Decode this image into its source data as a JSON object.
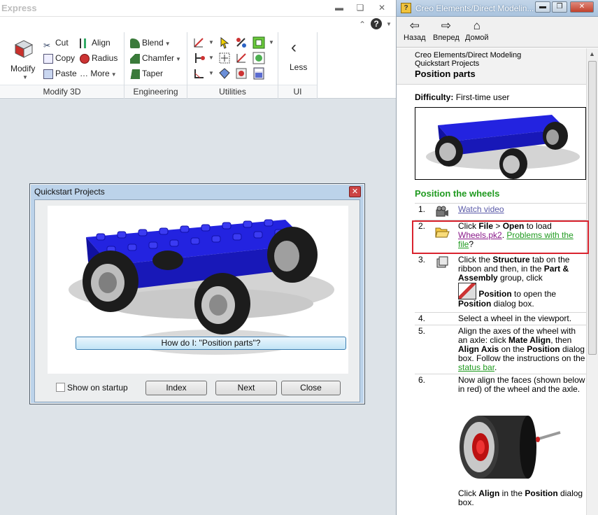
{
  "app": {
    "title": "Express"
  },
  "ribbon": {
    "modify": {
      "label": "Modify",
      "group": "Modify 3D"
    },
    "cut": "Cut",
    "copy": "Copy",
    "paste": "Paste",
    "align": "Align",
    "radius": "Radius",
    "more": "More",
    "blend": "Blend",
    "chamfer": "Chamfer",
    "taper": "Taper",
    "less": "Less",
    "groups": {
      "modify3d": "Modify 3D",
      "engineering": "Engineering",
      "utilities": "Utilities",
      "ui": "UI"
    }
  },
  "dialog": {
    "title": "Quickstart Projects",
    "how_do_i": "How do I: \"Position parts\"?",
    "show_on_startup": "Show on startup",
    "index": "Index",
    "next": "Next",
    "close": "Close"
  },
  "help": {
    "window_title": "Creo Elements/Direct Modelin...",
    "nav": {
      "back": "Назад",
      "forward": "Вперед",
      "home": "Домой"
    },
    "breadcrumb_1": "Creo Elements/Direct Modeling",
    "breadcrumb_2": "Quickstart Projects",
    "page_title": "Position parts",
    "difficulty_label": "Difficulty:",
    "difficulty_value": "First-time user",
    "section": "Position the wheels",
    "steps": [
      {
        "num": "1.",
        "link": "Watch video"
      },
      {
        "num": "2.",
        "t1": "Click ",
        "b1": "File",
        "t2": " > ",
        "b2": "Open",
        "t3": " to load ",
        "link1": "Wheels.pk2",
        "link2": "Problems with the file",
        "end": "?"
      },
      {
        "num": "3.",
        "t1": "Click the ",
        "b1": "Structure",
        "t2": " tab on the ribbon and then, in the ",
        "b2": "Part & Assembly",
        "t3": " group, click",
        "b3": "Position",
        "t4": " to open the ",
        "b4": "Position",
        "t5": " dialog box."
      },
      {
        "num": "4.",
        "text": "Select a wheel in the viewport."
      },
      {
        "num": "5.",
        "t1": "Align the axes of the wheel with an axle: click ",
        "b1": "Mate Align",
        "t2": ", then ",
        "b2": "Align Axis",
        "t3": " on the ",
        "b3": "Position",
        "t4": " dialog box. Follow the instructions on the ",
        "link": "status bar",
        "end": "."
      },
      {
        "num": "6.",
        "text": "Now align the faces (shown below in red) of the wheel and the axle.",
        "t1": "Click ",
        "b1": "Align",
        "t2": " in the ",
        "b2": "Position",
        "t3": " dialog box."
      }
    ]
  },
  "colors": {
    "accent_green": "#1f9a1f",
    "highlight_red": "#d9232e",
    "car_blue": "#1a1ae6"
  }
}
